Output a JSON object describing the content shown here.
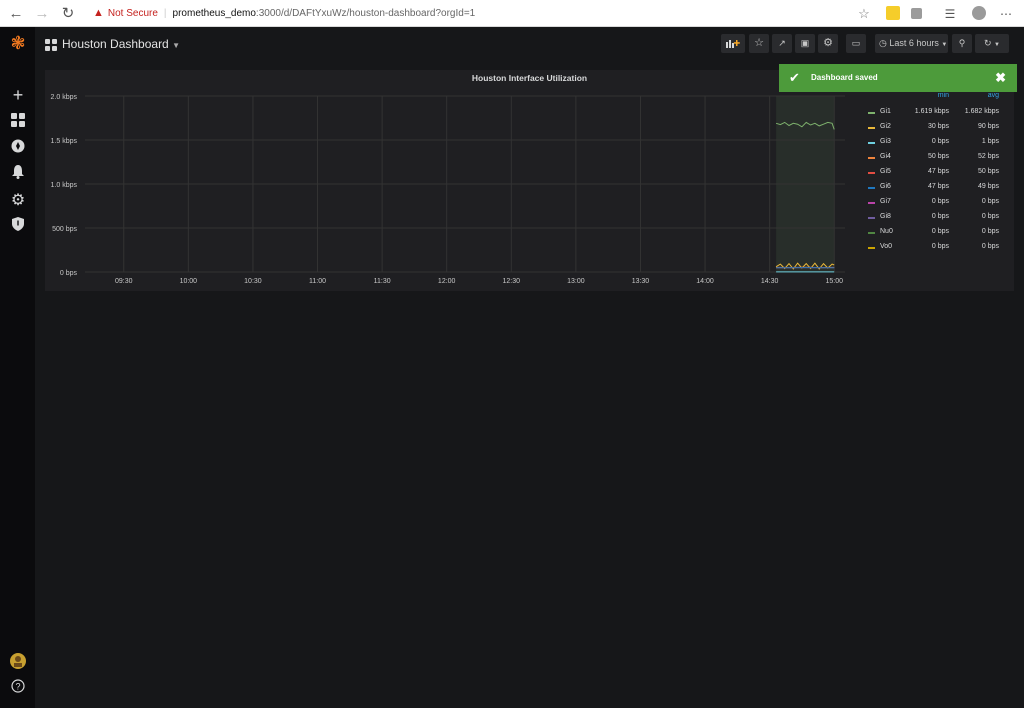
{
  "browser": {
    "security_label": "Not Secure",
    "url_host": "prometheus_demo",
    "url_path": ":3000/d/DAFtYxuWz/houston-dashboard?orgId=1"
  },
  "dashboard": {
    "title": "Houston Dashboard",
    "time_range_label": "Last 6 hours"
  },
  "toast": {
    "message": "Dashboard saved",
    "color": "#4d9b3b"
  },
  "panel": {
    "title": "Houston Interface Utilization"
  },
  "legend": {
    "col_min": "min",
    "col_avg": "avg",
    "rows": [
      {
        "name": "Gi1",
        "min": "1.619 kbps",
        "avg": "1.682 kbps",
        "color": "#7eb26d"
      },
      {
        "name": "Gi2",
        "min": "30 bps",
        "avg": "90 bps",
        "color": "#eab839"
      },
      {
        "name": "Gi3",
        "min": "0 bps",
        "avg": "1 bps",
        "color": "#6ed0e0"
      },
      {
        "name": "Gi4",
        "min": "50 bps",
        "avg": "52 bps",
        "color": "#ef843c"
      },
      {
        "name": "Gi5",
        "min": "47 bps",
        "avg": "50 bps",
        "color": "#e24d42"
      },
      {
        "name": "Gi6",
        "min": "47 bps",
        "avg": "49 bps",
        "color": "#1f78c1"
      },
      {
        "name": "Gi7",
        "min": "0 bps",
        "avg": "0 bps",
        "color": "#ba43a9"
      },
      {
        "name": "Gi8",
        "min": "0 bps",
        "avg": "0 bps",
        "color": "#705da0"
      },
      {
        "name": "Nu0",
        "min": "0 bps",
        "avg": "0 bps",
        "color": "#508642"
      },
      {
        "name": "Vo0",
        "min": "0 bps",
        "avg": "0 bps",
        "color": "#cca300"
      }
    ]
  },
  "chart_data": {
    "type": "line",
    "title": "Houston Interface Utilization",
    "xlabel": "",
    "ylabel": "",
    "y_tick_labels": [
      "0 bps",
      "500 bps",
      "1.0 kbps",
      "1.5 kbps",
      "2.0 kbps"
    ],
    "y_tick_values": [
      0,
      500,
      1000,
      1500,
      2000
    ],
    "ylim": [
      0,
      2000
    ],
    "x_tick_labels": [
      "09:30",
      "10:00",
      "10:30",
      "11:00",
      "11:30",
      "12:00",
      "12:30",
      "13:00",
      "13:30",
      "14:00",
      "14:30",
      "15:00"
    ],
    "x_tick_minutes": [
      570,
      600,
      630,
      660,
      690,
      720,
      750,
      780,
      810,
      840,
      870,
      900
    ],
    "xlim_minutes": [
      552,
      905
    ],
    "highlight_region_minutes": [
      873,
      900
    ],
    "grid": true,
    "legend_position": "right",
    "series": [
      {
        "name": "Gi1",
        "color": "#7eb26d",
        "x": [
          873,
          875,
          877,
          879,
          881,
          883,
          885,
          887,
          889,
          891,
          893,
          895,
          897,
          899,
          900
        ],
        "y": [
          1690,
          1675,
          1700,
          1665,
          1690,
          1680,
          1650,
          1700,
          1670,
          1690,
          1660,
          1680,
          1700,
          1690,
          1620
        ]
      },
      {
        "name": "Gi2",
        "color": "#eab839",
        "x": [
          873,
          875,
          877,
          879,
          881,
          883,
          885,
          887,
          889,
          891,
          893,
          895,
          897,
          899,
          900
        ],
        "y": [
          60,
          90,
          40,
          95,
          35,
          100,
          45,
          95,
          40,
          100,
          35,
          95,
          45,
          90,
          80
        ]
      },
      {
        "name": "Gi4",
        "color": "#ef843c",
        "x": [
          873,
          880,
          887,
          894,
          900
        ],
        "y": [
          52,
          51,
          53,
          50,
          52
        ]
      },
      {
        "name": "Gi5",
        "color": "#e24d42",
        "x": [
          873,
          880,
          887,
          894,
          900
        ],
        "y": [
          49,
          48,
          51,
          50,
          50
        ]
      },
      {
        "name": "Gi6",
        "color": "#1f78c1",
        "x": [
          873,
          880,
          887,
          894,
          900
        ],
        "y": [
          48,
          49,
          50,
          48,
          49
        ]
      },
      {
        "name": "Gi3",
        "color": "#6ed0e0",
        "x": [
          873,
          900
        ],
        "y": [
          1,
          1
        ]
      }
    ]
  },
  "toolbar": {
    "add_panel_icon": "add-panel-icon",
    "star_icon": "star-icon",
    "share_icon": "share-icon",
    "save_icon": "save-icon",
    "settings_icon": "gear-icon",
    "tv_icon": "monitor-icon",
    "zoom_icon": "zoom-out-icon",
    "refresh_icon": "refresh-icon"
  }
}
